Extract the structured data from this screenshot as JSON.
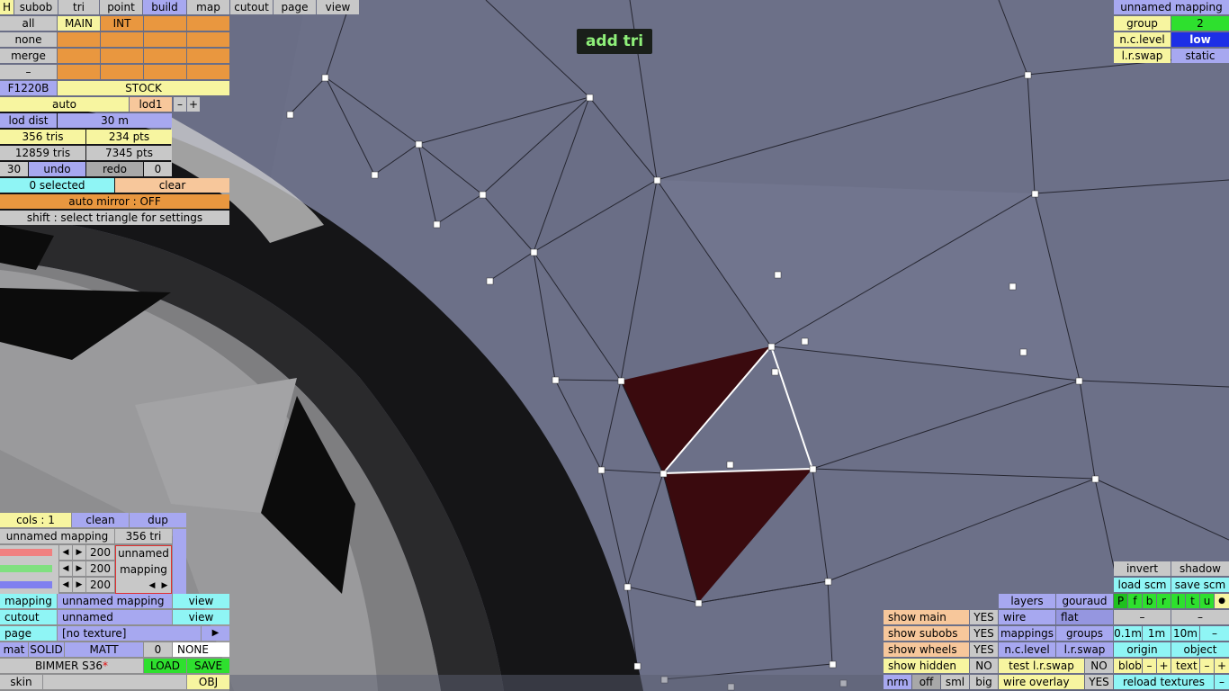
{
  "tabs": [
    "H",
    "subob",
    "tri",
    "point",
    "build",
    "map",
    "cutout",
    "page",
    "view"
  ],
  "active_tab": "build",
  "layer_rows": {
    "all": "all",
    "none": "none",
    "merge": "merge",
    "dash": "–",
    "main": "MAIN",
    "int": "INT"
  },
  "f1220b": "F1220B",
  "stock": "STOCK",
  "auto": "auto",
  "lod1": "lod1",
  "minus": "–",
  "plus": "+",
  "lod_dist_label": "lod dist",
  "lod_dist_value": "30 m",
  "tris_lod": "356 tris",
  "pts_lod": "234 pts",
  "tris_total": "12859 tris",
  "pts_total": "7345 pts",
  "undo_count": "30",
  "undo": "undo",
  "redo": "redo",
  "redo_count": "0",
  "selected": "0 selected",
  "clear": "clear",
  "auto_mirror": "auto mirror : OFF",
  "hint": "shift : select triangle for settings",
  "mode_badge": "add tri",
  "mapping_panel": {
    "title": "unnamed mapping",
    "group_label": "group",
    "group_value": "2",
    "nc_label": "n.c.level",
    "nc_value": "low",
    "lr_label": "l.r.swap",
    "lr_value": "static"
  },
  "bottom_left": {
    "cols": "cols : 1",
    "clean": "clean",
    "dup": "dup",
    "mapping_name": "unnamed mapping",
    "tri_count": "356 tri",
    "rgb": [
      "200",
      "200",
      "200"
    ],
    "swatch_label_1": "unnamed",
    "swatch_label_2": "mapping",
    "mapping_label": "mapping",
    "mapping_value": "unnamed mapping",
    "view": "view",
    "cutout_label": "cutout",
    "cutout_value": "unnamed",
    "view2": "view",
    "page_label": "page",
    "page_value": "[no texture]",
    "page_arrow": "▶",
    "mat": "mat",
    "solid": "SOLID",
    "matt": "MATT",
    "mat_num": "0",
    "none": "NONE",
    "car_name": "BIMMER S36",
    "car_mark": "*",
    "load": "LOAD",
    "save": "SAVE",
    "skin": "skin",
    "obj": "OBJ"
  },
  "bottom_center": {
    "show_main": "show main",
    "show_main_v": "YES",
    "show_subobs": "show subobs",
    "show_subobs_v": "YES",
    "show_wheels": "show wheels",
    "show_wheels_v": "YES",
    "show_hidden": "show hidden",
    "show_hidden_v": "NO",
    "nrm": "nrm",
    "off": "off",
    "sml": "sml",
    "big": "big",
    "layers": "layers",
    "gouraud": "gouraud",
    "wire": "wire",
    "flat": "flat",
    "mappings": "mappings",
    "groups": "groups",
    "nclevel": "n.c.level",
    "lrswap": "l.r.swap",
    "test_lr": "test l.r.swap",
    "test_lr_v": "NO",
    "wire_overlay": "wire overlay",
    "wire_overlay_v": "YES"
  },
  "bottom_right": {
    "invert": "invert",
    "shadow": "shadow",
    "load_scm": "load scm",
    "save_scm": "save scm",
    "views": [
      "P",
      "f",
      "b",
      "r",
      "l",
      "t",
      "u",
      "●"
    ],
    "dash1": "–",
    "dash2": "–",
    "s01": "0.1m",
    "s1": "1m",
    "s10": "10m",
    "sminus": "–",
    "origin": "origin",
    "object": "object",
    "blob": "blob",
    "text": "text",
    "reload": "reload textures",
    "rminus": "–"
  },
  "colors": {
    "accent": "#a7a8f0",
    "selected_tri": "#3a0a0e",
    "viewport": "#6d7188"
  }
}
